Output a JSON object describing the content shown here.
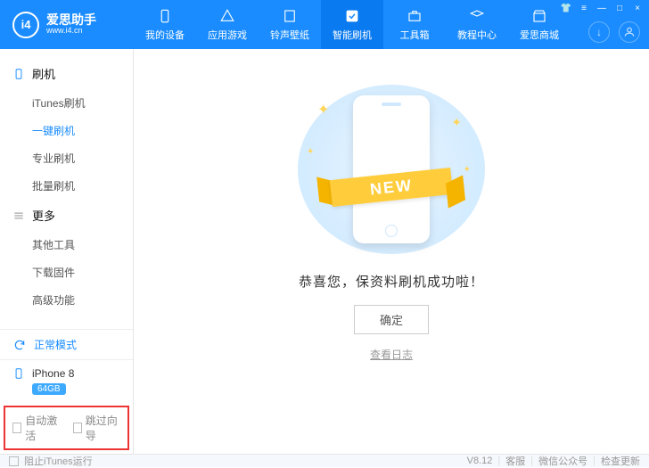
{
  "app": {
    "title": "爱思助手",
    "subtitle": "www.i4.cn",
    "logo_text": "i4"
  },
  "nav": [
    {
      "label": "我的设备"
    },
    {
      "label": "应用游戏"
    },
    {
      "label": "铃声壁纸"
    },
    {
      "label": "智能刷机"
    },
    {
      "label": "工具箱"
    },
    {
      "label": "教程中心"
    },
    {
      "label": "爱思商城"
    }
  ],
  "sidebar": {
    "group1_title": "刷机",
    "group1_items": [
      "iTunes刷机",
      "一键刷机",
      "专业刷机",
      "批量刷机"
    ],
    "group2_title": "更多",
    "group2_items": [
      "其他工具",
      "下载固件",
      "高级功能"
    ],
    "mode_label": "正常模式",
    "device_name": "iPhone 8",
    "device_badge": "64GB"
  },
  "options": {
    "auto_activate": "自动激活",
    "skip_guide": "跳过向导"
  },
  "main": {
    "ribbon": "NEW",
    "success": "恭喜您，保资料刷机成功啦！",
    "confirm": "确定",
    "view_log": "查看日志"
  },
  "footer": {
    "block_itunes": "阻止iTunes运行",
    "version": "V8.12",
    "support": "客服",
    "wechat": "微信公众号",
    "check_update": "检查更新"
  }
}
